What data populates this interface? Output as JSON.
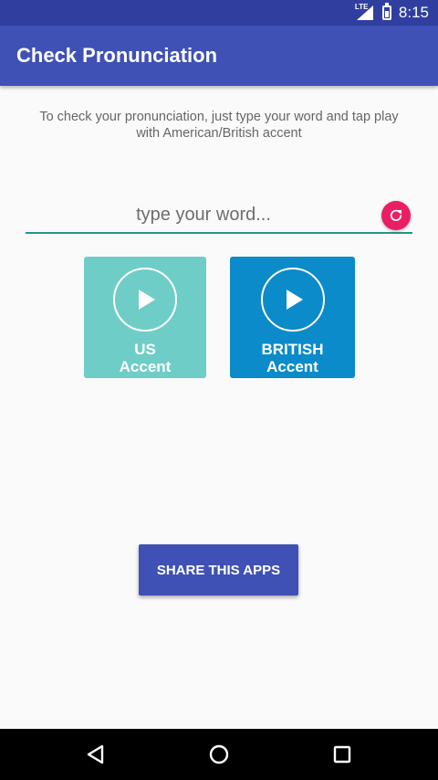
{
  "status_bar": {
    "network": "LTE",
    "time": "8:15"
  },
  "app_bar": {
    "title": "Check Pronunciation"
  },
  "instructions": {
    "line1": "To check your pronunciation, just type your word and tap play",
    "line2": "with American/British accent"
  },
  "word_input": {
    "value": "",
    "placeholder": "type your word..."
  },
  "accent_buttons": [
    {
      "line1": "US",
      "line2": "Accent",
      "color": "#6fcdc7"
    },
    {
      "line1": "BRITISH",
      "line2": "Accent",
      "color": "#0b8bc9"
    }
  ],
  "share_button": {
    "label": "SHARE THIS APPS"
  },
  "colors": {
    "primary": "#3f51b5",
    "primary_dark": "#303f9f",
    "refresh_accent": "#e91e63",
    "input_underline": "#22968a"
  },
  "icons": {
    "status": [
      "lte-signal-icon",
      "battery-icon"
    ],
    "input": "refresh-icon",
    "accent": "play-icon",
    "nav": [
      "back-icon",
      "home-icon",
      "recents-icon"
    ]
  }
}
